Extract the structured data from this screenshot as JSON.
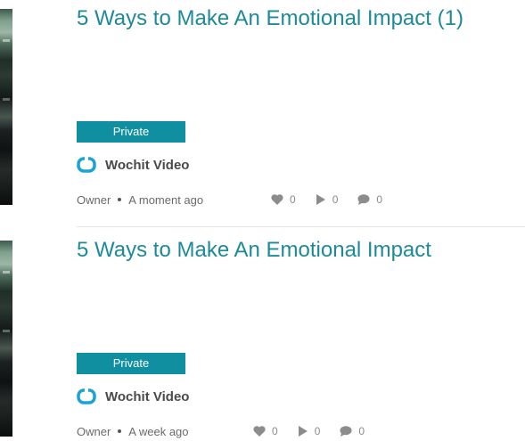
{
  "items": [
    {
      "title": "5 Ways to Make An Emotional Impact (1)",
      "badge": "Private",
      "author": "Wochit Video",
      "role": "Owner",
      "time": "A moment ago",
      "likes": "0",
      "plays": "0",
      "comments": "0"
    },
    {
      "title": "5 Ways to Make An Emotional Impact",
      "badge": "Private",
      "author": "Wochit Video",
      "role": "Owner",
      "time": "A week ago",
      "likes": "0",
      "plays": "0",
      "comments": "0"
    }
  ],
  "icons": {
    "author_logo": "wochit-logo-icon",
    "likes": "heart-icon",
    "plays": "play-icon",
    "comments": "comment-icon"
  },
  "colors": {
    "title": "#1e8a99",
    "badge_bg": "#0f8fa0",
    "logo": "#1aa3d4",
    "stat_icon": "#8c8c8c"
  }
}
